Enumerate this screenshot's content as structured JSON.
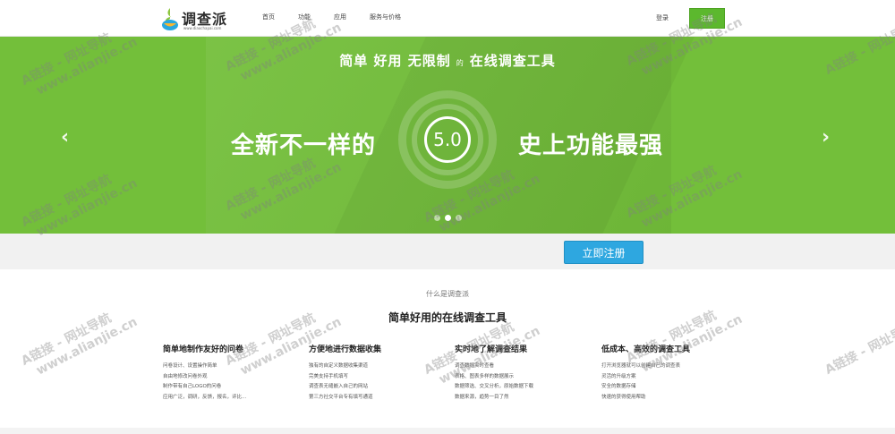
{
  "header": {
    "logo_name": "调查派",
    "logo_url": "www.diaochapai.com",
    "nav": [
      "首页",
      "功能",
      "应用",
      "服务与价格"
    ],
    "login": "登录",
    "register": "注册"
  },
  "banner": {
    "title_part1": "简单 好用 无限制",
    "title_small": "的",
    "title_part2": "在线调查工具",
    "left_text": "全新不一样的",
    "version": "5.0",
    "right_text": "史上功能最强",
    "prev_arrow": "‹",
    "next_arrow": "›",
    "slide_count": 3,
    "active_slide": 2,
    "color": "#73bf3a"
  },
  "cta": {
    "label": "立即注册",
    "color": "#2ea7e0"
  },
  "intro": {
    "subtitle": "什么是调查派",
    "title": "简单好用的在线调查工具"
  },
  "features": [
    {
      "title": "简单地制作友好的问卷",
      "items": [
        "问卷设计、设置操作简单",
        "自由地修改问卷外观",
        "制作带有自己LOGO的问卷",
        "应用广泛，调研，反馈，报名，评比..."
      ]
    },
    {
      "title": "方便地进行数据收集",
      "items": [
        "独有的自定义数据收集渠道",
        "完美支持手机填写",
        "调查表无缝嵌入自己的网站",
        "第三方社交平台专有填写通道"
      ]
    },
    {
      "title": "实时地了解调查结果",
      "items": [
        "调查数据实时查看",
        "表格、图表多样的数据展示",
        "数据筛选、交叉分析，原始数据下载",
        "数据来源，趋势一目了然"
      ]
    },
    {
      "title": "低成本、高效的调查工具",
      "items": [
        "打开浏览器就可以创建自己的调查表",
        "灵活的升级方案",
        "安全的数据存储",
        "快速的获得使用帮助"
      ]
    }
  ],
  "watermark": {
    "line1": "A链接 - 网址导航",
    "line2": "www.alianjie.cn"
  }
}
